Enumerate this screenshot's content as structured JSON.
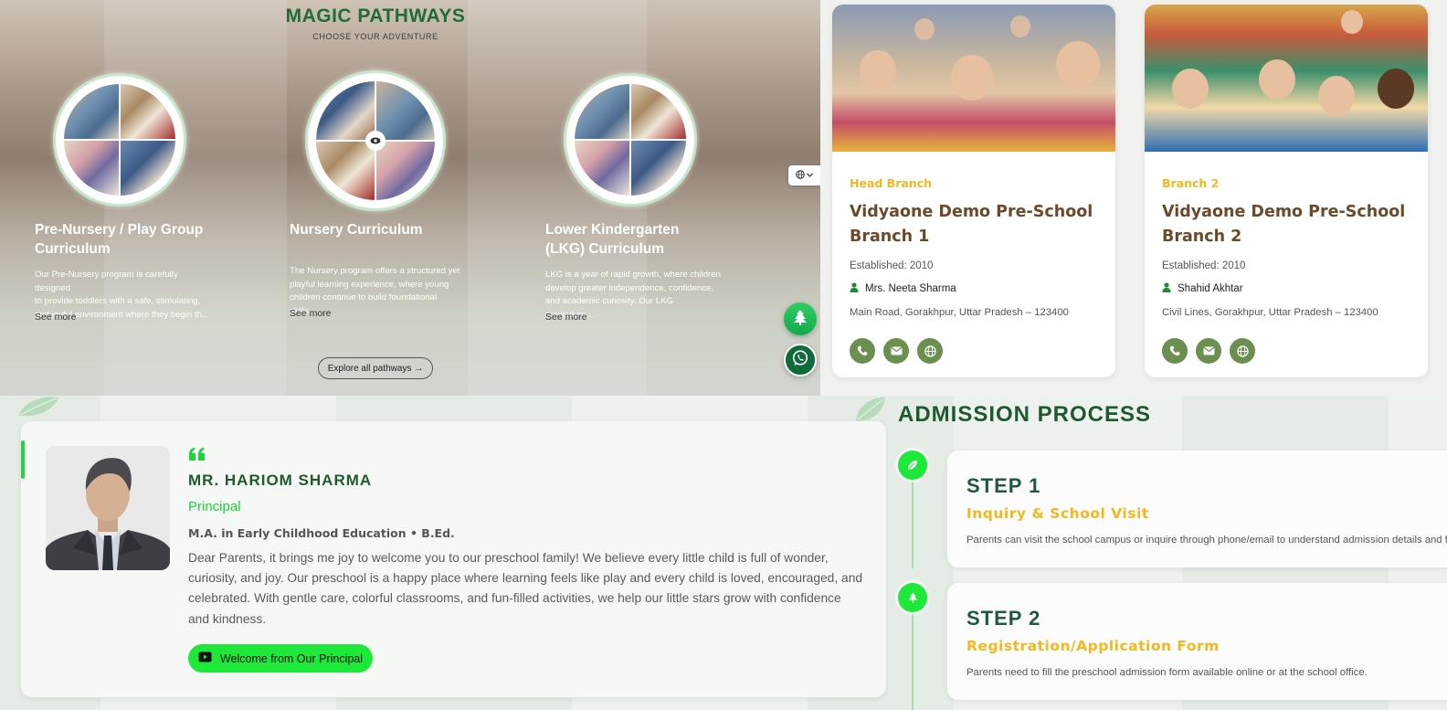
{
  "pathways": {
    "title": "MAGIC PATHWAYS",
    "subtitle": "CHOOSE YOUR ADVENTURE",
    "items": [
      {
        "heading_line1": "Pre-Nursery / Play Group",
        "heading_line2": "Curriculum",
        "text_lines": [
          "Our Pre-Nursery program is carefully designed",
          "to provide toddlers with a safe, stimulating,",
          "and joyful environment where they begin th..."
        ],
        "more": "See more"
      },
      {
        "heading_line1": "Nursery Curriculum",
        "heading_line2": "",
        "text_lines": [
          "The Nursery program offers a structured yet",
          "playful learning experience, where young",
          "children continue to build foundational skills..."
        ],
        "more": "See more"
      },
      {
        "heading_line1": "Lower Kindergarten",
        "heading_line2": "(LKG) Curriculum",
        "text_lines": [
          "LKG is a year of rapid growth, where children",
          "develop greater independence, confidence,",
          "and academic curiosity. Our LKG curriculum..."
        ],
        "more": "See more"
      }
    ],
    "explore_label": "Explore all pathways →"
  },
  "branches": [
    {
      "tag": "Head Branch",
      "name": "Vidyaone Demo Pre-School Branch 1",
      "established": "Established: 2010",
      "person": "Mrs. Neeta Sharma",
      "address": "Main Road, Gorakhpur, Uttar Pradesh – 123400"
    },
    {
      "tag": "Branch 2",
      "name": "Vidyaone Demo Pre-School Branch 2",
      "established": "Established: 2010",
      "person": "Shahid Akhtar",
      "address": "Civil Lines, Gorakhpur, Uttar Pradesh – 123400"
    }
  ],
  "principal": {
    "name": "MR. HARIOM SHARMA",
    "role": "Principal",
    "qualification": "M.A. in Early Childhood Education • B.Ed.",
    "message": "Dear Parents, it brings me joy to welcome you to our preschool family! We believe every little child is full of wonder, curiosity, and joy. Our preschool is a happy place where learning feels like play and every child is loved, encouraged, and celebrated. With gentle care, colorful classrooms, and fun-filled activities, we help our little stars grow with confidence and kindness.",
    "video_button": "Welcome from Our Principal"
  },
  "admission": {
    "title": "ADMISSION PROCESS",
    "steps": [
      {
        "number": "STEP 1",
        "title": "Inquiry & School Visit",
        "description": "Parents can visit the school campus or inquire through phone/email to understand admission details and facilities."
      },
      {
        "number": "STEP 2",
        "title": "Registration/Application Form",
        "description": "Parents need to fill the preschool admission form available online or at the school office."
      }
    ]
  },
  "colors": {
    "brand_green": "#1f6b3c",
    "accent_green": "#1ee93a",
    "accent_yellow": "#f2b81e",
    "branch_brown": "#6b4a2b",
    "icon_olive": "#6a8f4e"
  },
  "icons": {
    "language": "globe-icon",
    "floating_1": "tree-icon",
    "floating_2": "whatsapp-icon",
    "contact": [
      "phone-icon",
      "mail-icon",
      "globe-icon"
    ],
    "quote": "quote-icon",
    "video": "youtube-icon"
  }
}
